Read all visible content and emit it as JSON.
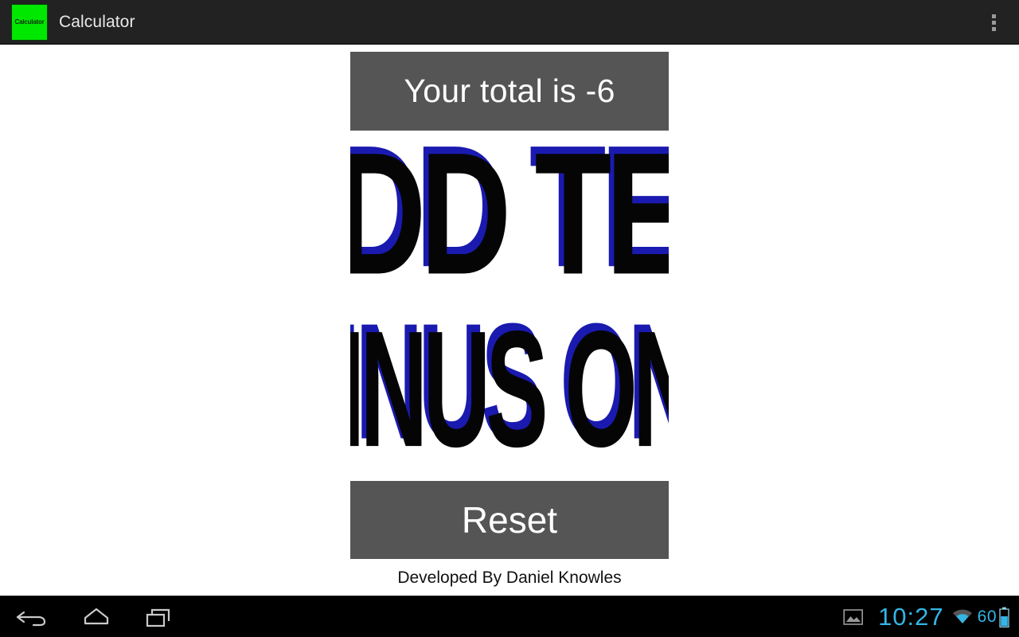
{
  "actionbar": {
    "app_icon_label": "Calculator",
    "app_icon_color": "#00e800",
    "title": "Calculator",
    "overflow_name": "more-options"
  },
  "app": {
    "total_display": {
      "text": "Your total is -6",
      "total_value": -6,
      "prefix": "Your total is",
      "bg_color": "#555555",
      "text_color": "#ffffff"
    },
    "buttons": [
      {
        "name": "add-ten-button",
        "label": "ADD TEN",
        "style": "wordart-3d",
        "face_color": "#050505",
        "shadow_color": "#1a1ab0"
      },
      {
        "name": "minus-one-button",
        "label": "MINUS ONE",
        "style": "wordart-3d",
        "face_color": "#050505",
        "shadow_color": "#1a1ab0"
      }
    ],
    "reset": {
      "label": "Reset",
      "bg_color": "#555555",
      "text_color": "#ffffff"
    },
    "credit": "Developed By Daniel Knowles"
  },
  "navbar": {
    "back_icon": "back-arrow-icon",
    "home_icon": "home-icon",
    "recents_icon": "recents-icon"
  },
  "statusbar": {
    "screenshot_icon": "screenshot-icon",
    "clock": "10:27",
    "wifi_icon": "wifi-icon",
    "battery_percent": "60",
    "battery_icon": "battery-icon",
    "accent_color": "#33b5e5"
  }
}
